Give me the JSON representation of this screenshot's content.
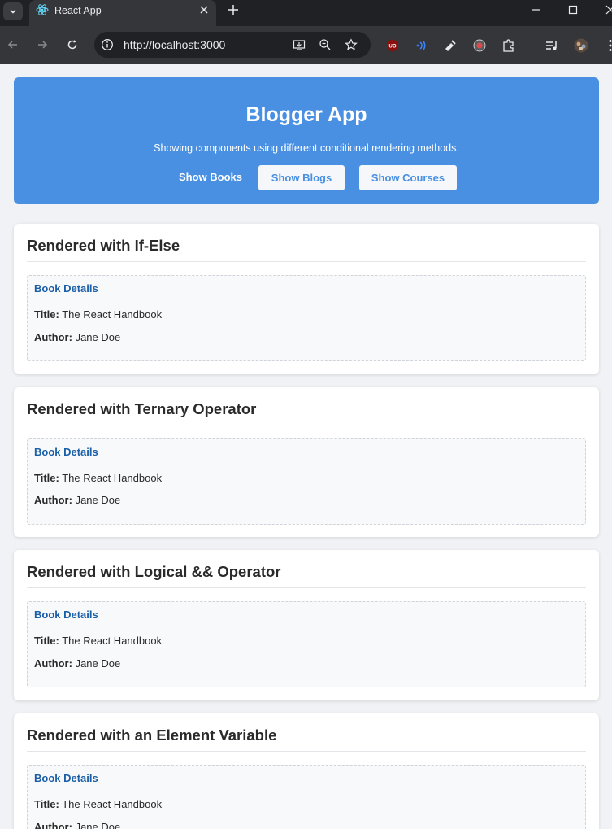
{
  "browser": {
    "tab_title": "React App",
    "url": "http://localhost:3000"
  },
  "hero": {
    "title": "Blogger App",
    "subtitle": "Showing components using different conditional rendering methods.",
    "buttons": [
      "Show Books",
      "Show Blogs",
      "Show Courses"
    ],
    "accent_color": "#4a90e2"
  },
  "sections": [
    {
      "heading": "Rendered with If-Else",
      "detail_title": "Book Details",
      "title_label": "Title:",
      "title_value": "The React Handbook",
      "author_label": "Author:",
      "author_value": "Jane Doe"
    },
    {
      "heading": "Rendered with Ternary Operator",
      "detail_title": "Book Details",
      "title_label": "Title:",
      "title_value": "The React Handbook",
      "author_label": "Author:",
      "author_value": "Jane Doe"
    },
    {
      "heading": "Rendered with Logical && Operator",
      "detail_title": "Book Details",
      "title_label": "Title:",
      "title_value": "The React Handbook",
      "author_label": "Author:",
      "author_value": "Jane Doe"
    },
    {
      "heading": "Rendered with an Element Variable",
      "detail_title": "Book Details",
      "title_label": "Title:",
      "title_value": "The React Handbook",
      "author_label": "Author:",
      "author_value": "Jane Doe"
    }
  ]
}
